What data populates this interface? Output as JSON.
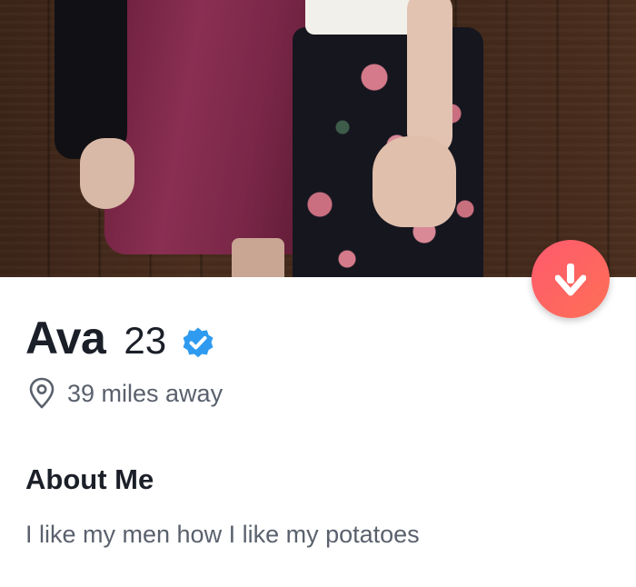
{
  "profile": {
    "name": "Ava",
    "age": "23",
    "distance": "39 miles away",
    "about_heading": "About Me",
    "bio": "I like my men how I like my potatoes"
  },
  "icons": {
    "action": "arrow-down-icon",
    "verified": "verified-badge-icon",
    "location": "location-pin-icon"
  },
  "colors": {
    "action_start": "#ff5a6e",
    "action_end": "#fd6f55",
    "verified": "#2f9bf0",
    "text_primary": "#1b1f28",
    "text_secondary": "#5a616d"
  }
}
